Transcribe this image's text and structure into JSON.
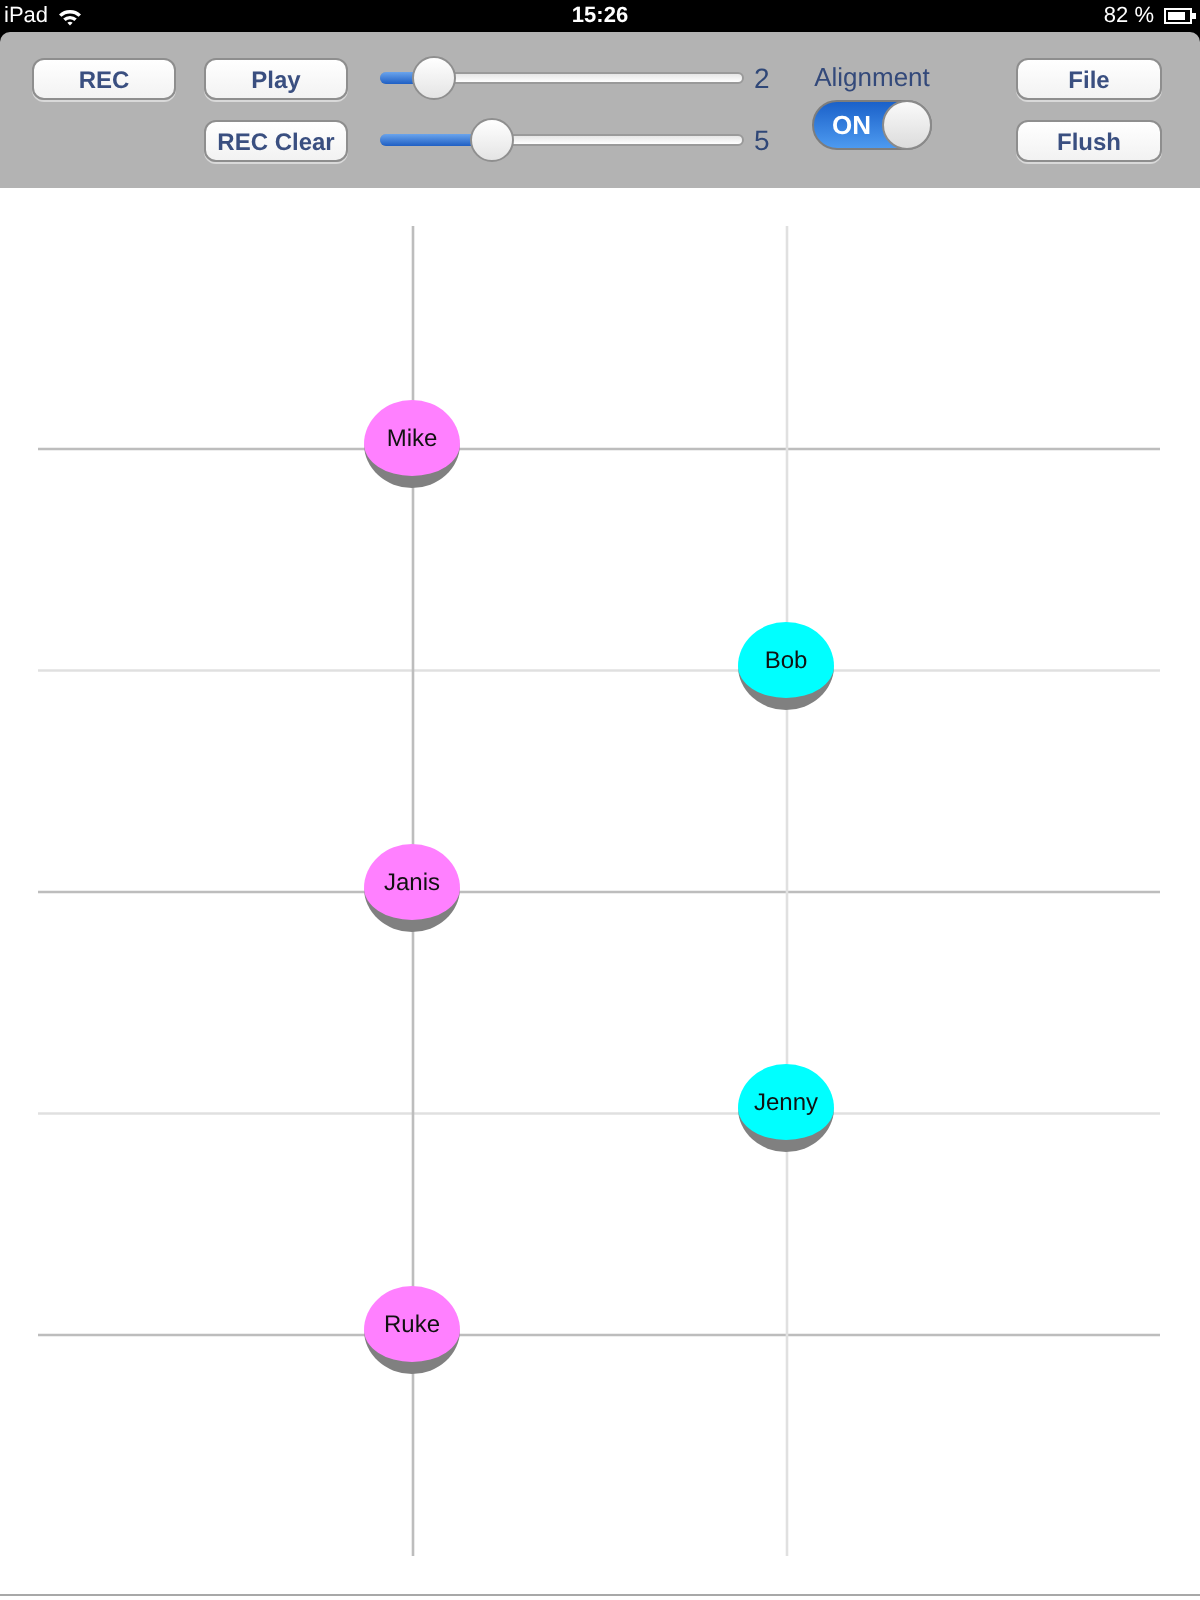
{
  "status_bar": {
    "device": "iPad",
    "time": "15:26",
    "battery": "82 %"
  },
  "toolbar": {
    "rec_button": "REC",
    "play_button": "Play",
    "rec_clear_button": "REC Clear",
    "sliders": [
      {
        "level": 0.15,
        "reading": "2"
      },
      {
        "level": 0.31,
        "reading": "5"
      }
    ],
    "alignment": {
      "label": "Alignment",
      "switch": "ON",
      "on": true
    },
    "file_button": "File",
    "flush_button": "Flush"
  },
  "canvas": {
    "nodes": [
      {
        "name": "Mike",
        "color": "#ff80ff",
        "kind": "left"
      },
      {
        "name": "Bob",
        "color": "#00ffff",
        "kind": "right"
      },
      {
        "name": "Janis",
        "color": "#ff80ff",
        "kind": "left"
      },
      {
        "name": "Jenny",
        "color": "#00ffff",
        "kind": "right"
      },
      {
        "name": "Ruke",
        "color": "#ff80ff",
        "kind": "left"
      }
    ]
  }
}
